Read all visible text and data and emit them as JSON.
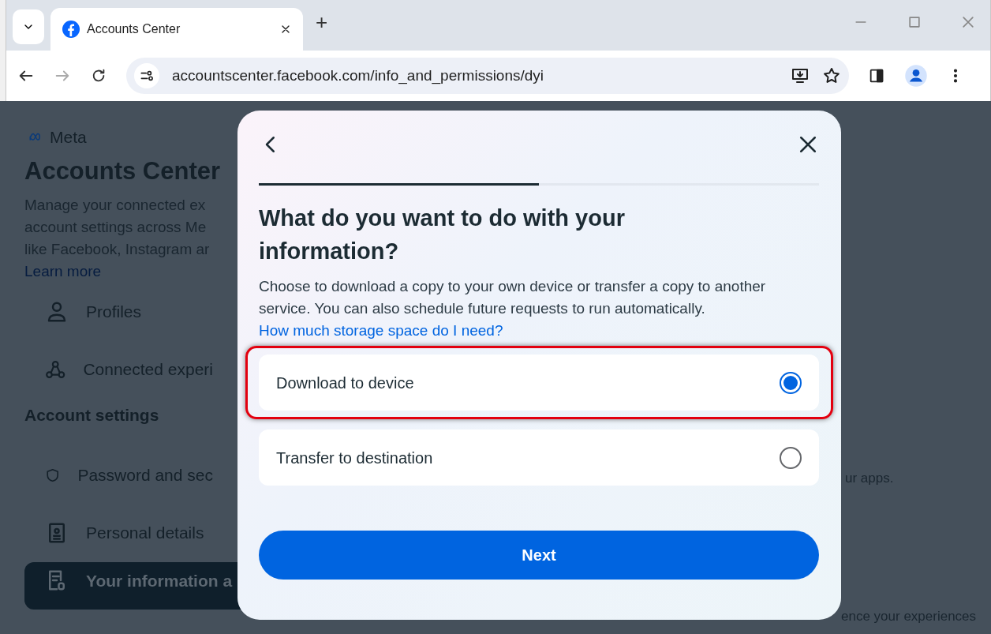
{
  "browser": {
    "tab_title": "Accounts Center",
    "new_tab": "+",
    "url": "accountscenter.facebook.com/info_and_permissions/dyi"
  },
  "page": {
    "brand": "Meta",
    "title": "Accounts Center",
    "description_lines": [
      "Manage your connected ex",
      "account settings across Me",
      "like Facebook, Instagram ar"
    ],
    "learn_more": "Learn more",
    "nav": [
      {
        "label": "Profiles",
        "selected": false
      },
      {
        "label": "Connected experi",
        "selected": false
      }
    ],
    "section": "Account settings",
    "settings_nav": [
      {
        "label": "Password and sec",
        "selected": false
      },
      {
        "label": "Personal details",
        "selected": false
      },
      {
        "label": "Your information a",
        "selected": true
      }
    ],
    "right_texts": [
      "ur apps.",
      "ence your experiences"
    ]
  },
  "dialog": {
    "progress": {
      "level": 0.5
    },
    "title": "What do you want to do with your information?",
    "description": "Choose to download a copy to your own device or transfer a copy to another service. You can also schedule future requests to run automatically.",
    "link": "How much storage space do I need?",
    "options": [
      {
        "label": "Download to device",
        "selected": true,
        "highlighted": true
      },
      {
        "label": "Transfer to destination",
        "selected": false,
        "highlighted": false
      }
    ],
    "next_button": "Next"
  }
}
